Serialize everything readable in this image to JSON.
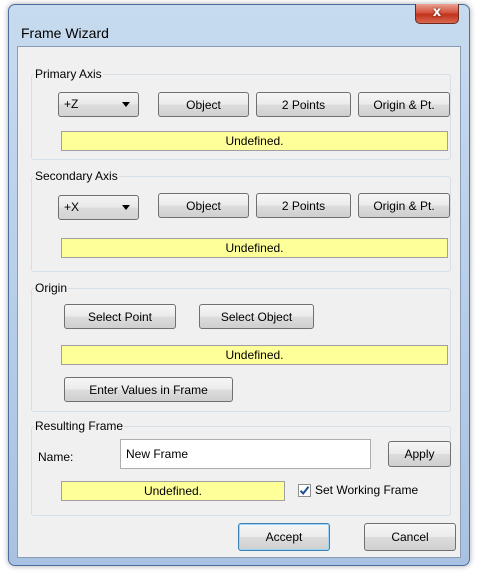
{
  "window": {
    "title": "Frame Wizard",
    "close_symbol": "x"
  },
  "primary_axis": {
    "group_label": "Primary Axis",
    "combo_value": "+Z",
    "object_label": "Object",
    "two_points_label": "2 Points",
    "origin_pt_label": "Origin & Pt.",
    "status": "Undefined."
  },
  "secondary_axis": {
    "group_label": "Secondary Axis",
    "combo_value": "+X",
    "object_label": "Object",
    "two_points_label": "2 Points",
    "origin_pt_label": "Origin & Pt.",
    "status": "Undefined."
  },
  "origin": {
    "group_label": "Origin",
    "select_point_label": "Select Point",
    "select_object_label": "Select Object",
    "status": "Undefined.",
    "enter_values_label": "Enter Values in Frame"
  },
  "resulting_frame": {
    "group_label": "Resulting Frame",
    "name_label": "Name:",
    "name_value": "New Frame",
    "apply_label": "Apply",
    "status": "Undefined.",
    "set_working_frame_label": "Set Working Frame",
    "set_working_frame_checked": true
  },
  "footer": {
    "accept_label": "Accept",
    "cancel_label": "Cancel"
  }
}
